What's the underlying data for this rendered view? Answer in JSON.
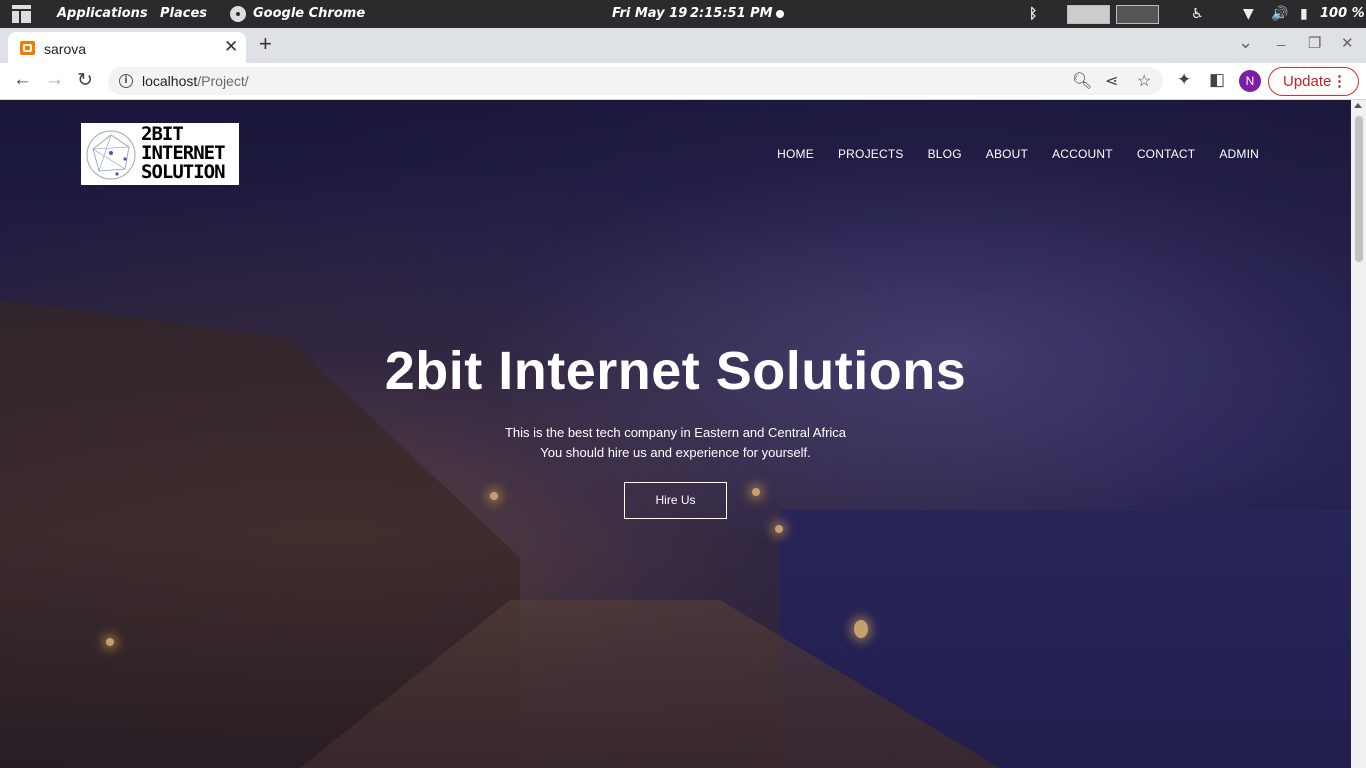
{
  "panel": {
    "applications": "Applications",
    "places": "Places",
    "browser": "Google Chrome",
    "date": "Fri May 19",
    "time": "2:15:51 PM",
    "battery": "100 %"
  },
  "tab": {
    "title": "sarova",
    "close": "✕",
    "new_tab": "+"
  },
  "window": {
    "tab_search": "⌄",
    "minimize": "_",
    "restore": "❐",
    "close": "✕"
  },
  "toolbar": {
    "back": "←",
    "forward": "→",
    "reload": "↻",
    "url_host": "localhost",
    "url_path": "/Project/",
    "avatar_initial": "N",
    "update_label": "Update",
    "menu": "⋮"
  },
  "site": {
    "logo_lines": [
      "2BIT",
      "INTERNET",
      "SOLUTION"
    ],
    "nav": [
      "HOME",
      "PROJECTS",
      "BLOG",
      "ABOUT",
      "ACCOUNT",
      "CONTACT",
      "ADMIN"
    ],
    "hero_title": "2bit Internet Solutions",
    "hero_line1": "This is the best tech company in Eastern and Central Africa",
    "hero_line2": "You should hire us and experience for yourself.",
    "cta": "Hire Us"
  },
  "colors": {
    "update_accent": "#d93025",
    "avatar": "#7b1fa2",
    "favicon": "#f57c00"
  }
}
